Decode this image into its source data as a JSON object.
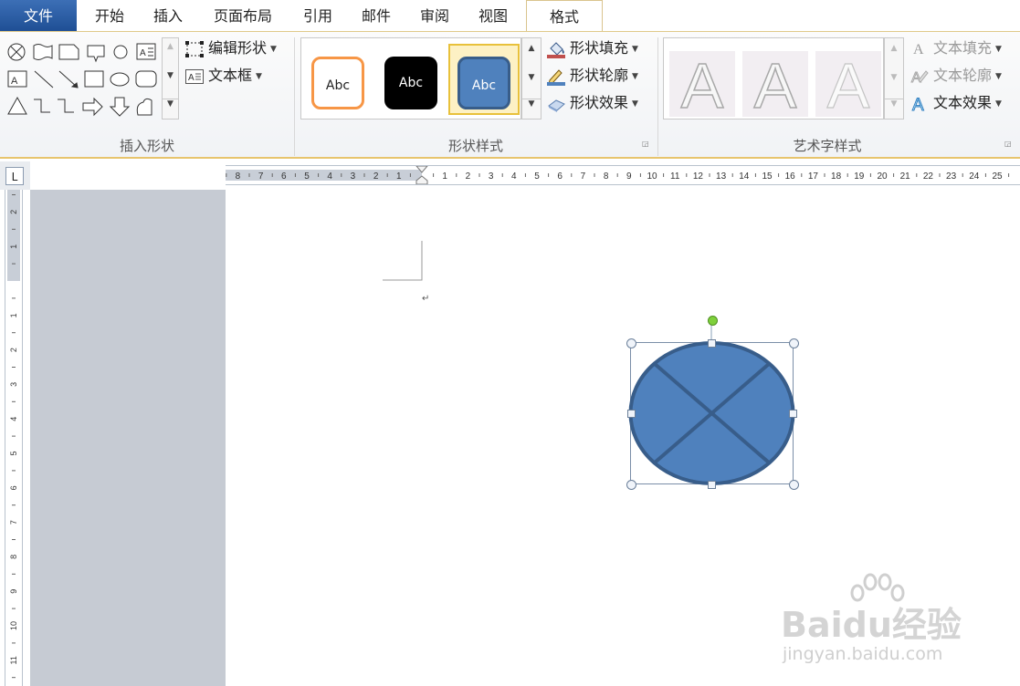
{
  "tabs": {
    "file": "文件",
    "home": "开始",
    "insert": "插入",
    "page_layout": "页面布局",
    "references": "引用",
    "mailings": "邮件",
    "review": "审阅",
    "view": "视图",
    "format": "格式"
  },
  "insert_shapes": {
    "group_label": "插入形状",
    "edit_shape": "编辑形状",
    "text_box": "文本框"
  },
  "shape_styles": {
    "group_label": "形状样式",
    "preset_label": "Abc",
    "shape_fill": "形状填充",
    "shape_outline": "形状轮廓",
    "shape_effects": "形状效果"
  },
  "wordart_styles": {
    "group_label": "艺术字样式",
    "letter": "A",
    "text_fill": "文本填充",
    "text_outline": "文本轮廓",
    "text_effects": "文本效果"
  },
  "ruler": {
    "corner_label": "L",
    "horizontal_left_numbers": [
      "8",
      "7",
      "6",
      "5",
      "4",
      "3",
      "2",
      "1"
    ],
    "horizontal_right_numbers": [
      "1",
      "2",
      "3",
      "4",
      "5",
      "6",
      "7",
      "8",
      "9",
      "10",
      "11",
      "12",
      "13",
      "14",
      "15",
      "16",
      "17",
      "18",
      "19",
      "20",
      "21",
      "22",
      "23",
      "24",
      "25"
    ],
    "vertical_top_numbers": [
      "2",
      "1"
    ],
    "vertical_numbers": [
      "1",
      "2",
      "3",
      "4",
      "5",
      "6",
      "7",
      "8",
      "9",
      "10",
      "11"
    ]
  },
  "document": {
    "paragraph_mark": "↵"
  },
  "watermark": {
    "logo": "Baidu经验",
    "url": "jingyan.baidu.com"
  },
  "colors": {
    "accent_blue": "#4f81bd",
    "accent_dark": "#385d8a",
    "file_tab": "#2b579a",
    "orange_preset": "#f79646",
    "rotation_handle": "#7ed03b"
  }
}
